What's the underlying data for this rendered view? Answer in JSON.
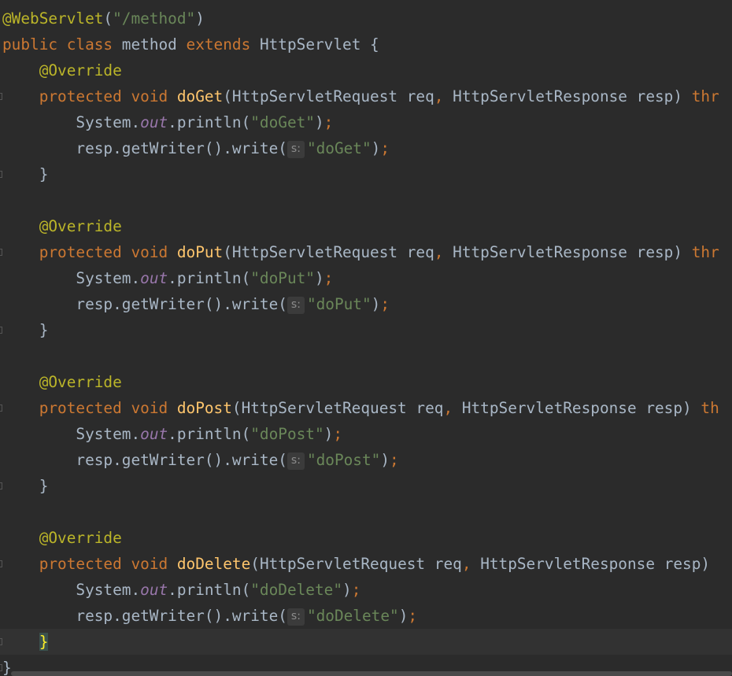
{
  "code": {
    "annotation_class": "@WebServlet",
    "servlet_path": "\"/method\"",
    "kw_public": "public",
    "kw_class": "class",
    "class_name": "method",
    "kw_extends": "extends",
    "super_class": "HttpServlet",
    "override": "@Override",
    "kw_protected": "protected",
    "kw_void": "void",
    "param_type_req": "HttpServletRequest",
    "param_req": "req",
    "param_type_resp": "HttpServletResponse",
    "param_resp": "resp",
    "kw_throws_clip": "thr",
    "kw_throws_clip_short": "th",
    "system": "System.",
    "out": "out",
    "println": ".println(",
    "writer": "resp.getWriter().write(",
    "hint_s": "s:",
    "methods": [
      {
        "name": "doGet",
        "literal": "\"doGet\""
      },
      {
        "name": "doPut",
        "literal": "\"doPut\""
      },
      {
        "name": "doPost",
        "literal": "\"doPost\""
      },
      {
        "name": "doDelete",
        "literal": "\"doDelete\""
      }
    ]
  }
}
